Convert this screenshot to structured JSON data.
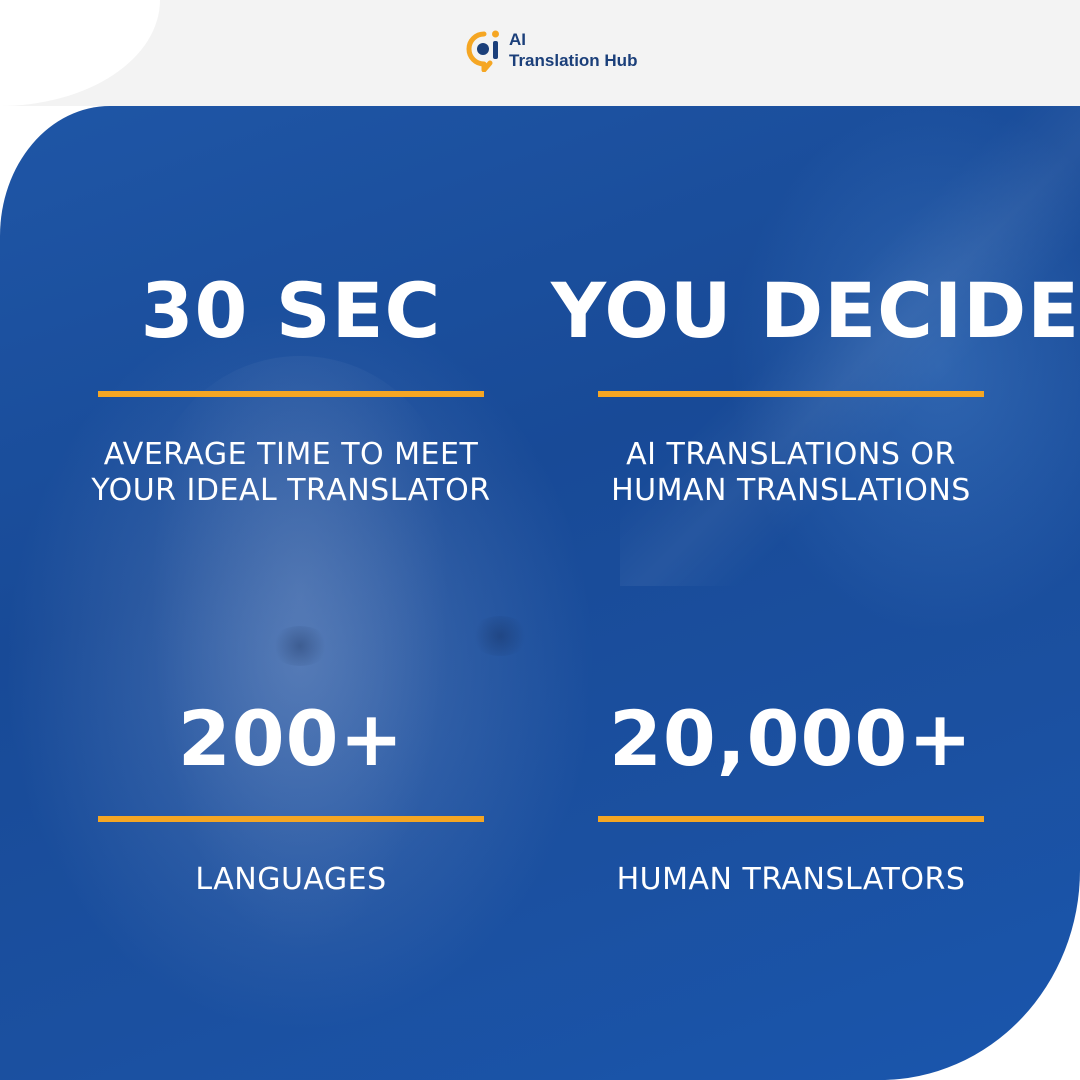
{
  "brand": {
    "line1": "AI",
    "line2": "Translation Hub",
    "logo_icon": "ai-chat-bubble-logo",
    "colors": {
      "brand_blue": "#1b3f7a",
      "accent_orange": "#f5a623",
      "panel_blue": "#1b4f9f"
    }
  },
  "stats": [
    {
      "value": "30 SEC",
      "caption": [
        "AVERAGE TIME TO MEET",
        "YOUR IDEAL TRANSLATOR"
      ]
    },
    {
      "value": "YOU DECIDE",
      "caption": [
        "AI TRANSLATIONS OR",
        "HUMAN TRANSLATIONS"
      ]
    },
    {
      "value": "200+",
      "caption": [
        "LANGUAGES"
      ]
    },
    {
      "value": "20,000+",
      "caption": [
        "HUMAN TRANSLATORS"
      ]
    }
  ]
}
